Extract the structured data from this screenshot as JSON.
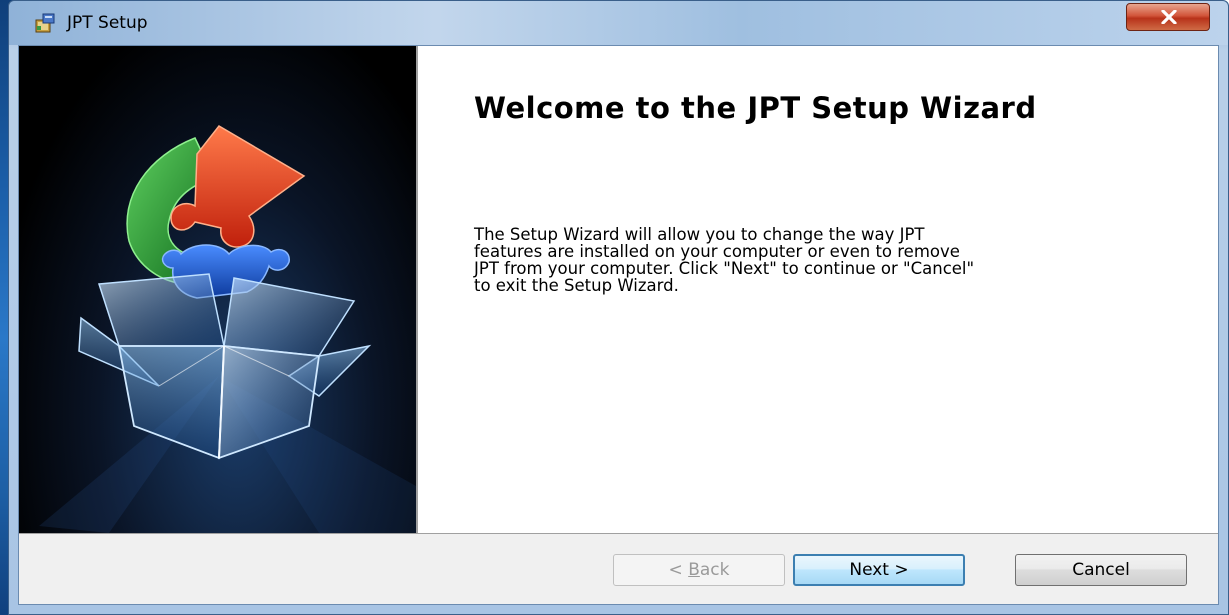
{
  "window": {
    "title": "JPT Setup",
    "close_icon": "close-x-icon",
    "app_icon": "installer-icon"
  },
  "banner": {
    "image": "puzzle-pieces-over-open-box-illustration"
  },
  "content": {
    "heading": "Welcome to the JPT Setup Wizard",
    "body": "The Setup Wizard will allow you to change the way JPT\nfeatures are installed on your computer or even to remove\nJPT from your computer.  Click \"Next\" to continue or \"Cancel\"\nto exit the Setup Wizard."
  },
  "buttons": {
    "back_prefix": "< ",
    "back_mnemonic": "B",
    "back_rest": "ack",
    "back_enabled": false,
    "next_label": "Next >",
    "cancel_label": "Cancel"
  },
  "colors": {
    "accent_default_button": "#3c7fb1",
    "banner_background": "#000000",
    "puzzle_red": "#e0391a",
    "puzzle_green": "#2a9a3a",
    "puzzle_blue": "#1c5fd0"
  }
}
